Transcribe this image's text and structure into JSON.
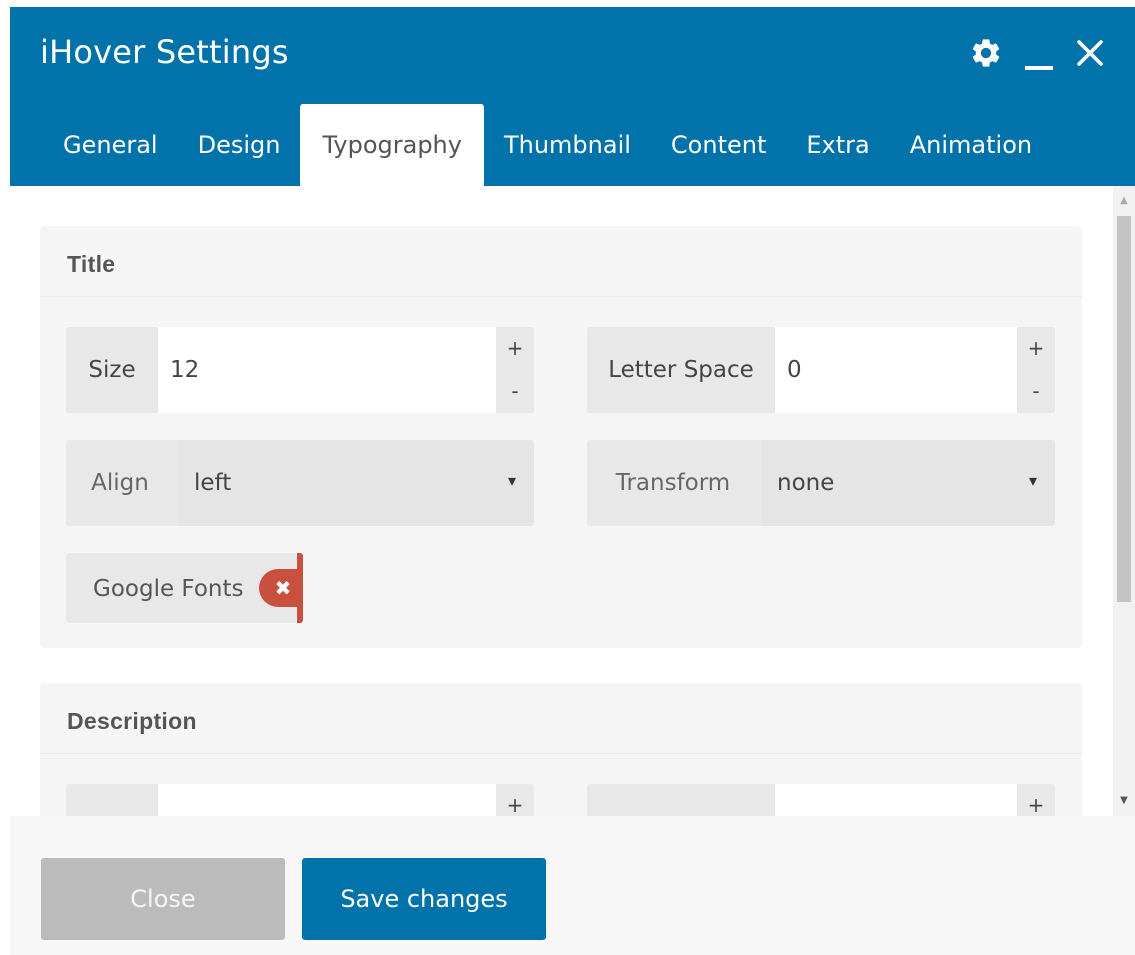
{
  "dialog": {
    "title": "iHover Settings",
    "icons": [
      "gear-icon",
      "minimize-icon",
      "close-icon"
    ]
  },
  "tabs": [
    {
      "label": "General"
    },
    {
      "label": "Design"
    },
    {
      "label": "Typography",
      "active": true
    },
    {
      "label": "Thumbnail"
    },
    {
      "label": "Content"
    },
    {
      "label": "Extra"
    },
    {
      "label": "Animation"
    }
  ],
  "title_panel": {
    "heading": "Title",
    "size": {
      "label": "Size",
      "value": "12",
      "plus": "+",
      "minus": "-"
    },
    "letter_space": {
      "label": "Letter Space",
      "value": "0",
      "plus": "+",
      "minus": "-"
    },
    "align": {
      "label": "Align",
      "value": "left",
      "arrow": "▾"
    },
    "transform": {
      "label": "Transform",
      "value": "none",
      "arrow": "▾"
    },
    "google_fonts": {
      "label": "Google Fonts",
      "toggle_state": "off",
      "toggle_icon": "✖"
    }
  },
  "description_panel": {
    "heading": "Description",
    "plus_left": "+",
    "plus_right": "+"
  },
  "footer": {
    "close_label": "Close",
    "save_label": "Save changes"
  },
  "colors": {
    "header_bg": "#0173aa",
    "save_button": "#0173aa",
    "close_button": "#bbbbbb",
    "toggle_off": "#c9503f"
  }
}
